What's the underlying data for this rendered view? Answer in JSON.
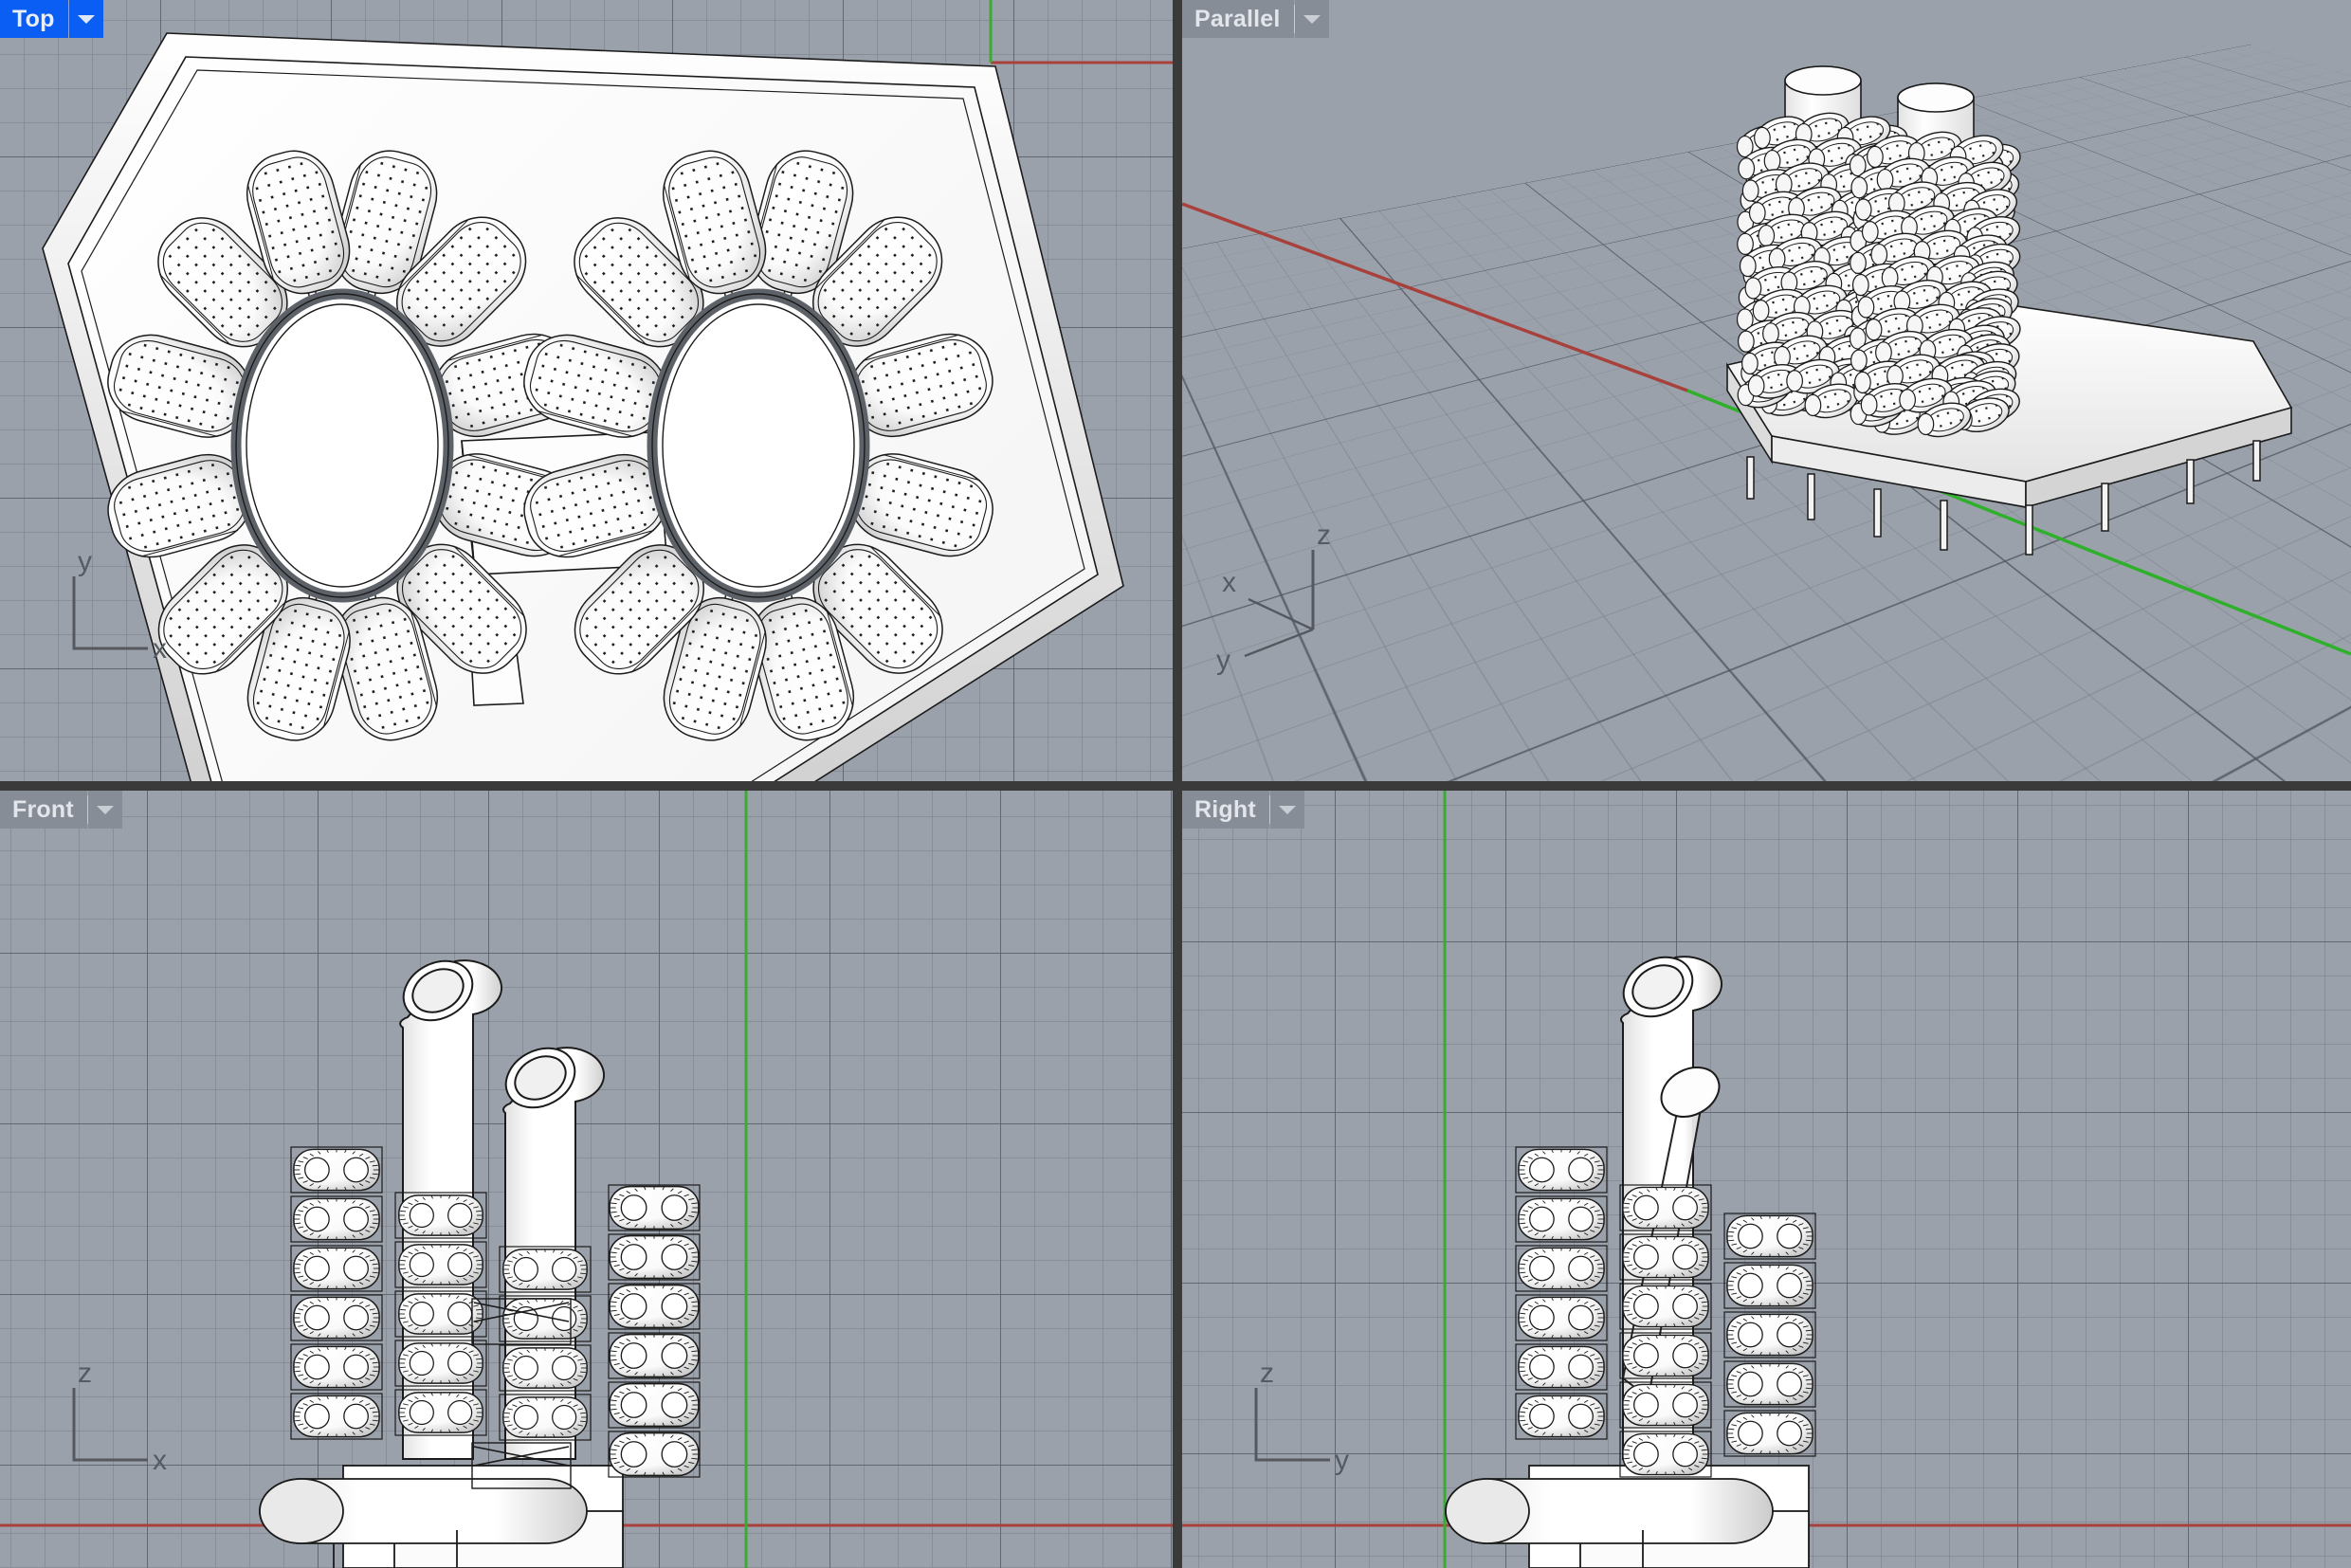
{
  "app": {
    "kind": "cad-modeler-four-viewport",
    "background_color": "#9aa1ab",
    "divider_color": "#3a3a3a"
  },
  "viewports": [
    {
      "id": "top",
      "title": "Top",
      "active": true,
      "projection": "orthographic",
      "title_bg": "#0b5ef4",
      "title_fg": "#e9eef7",
      "dropdown_icon": "chevron-down-icon",
      "gnomon": {
        "vertical_axis": "y",
        "horizontal_axis": "x"
      },
      "world_axes": [
        {
          "name": "x-axis",
          "color": "#a8413c",
          "orientation": "horizontal"
        },
        {
          "name": "y-axis",
          "color": "#3aaa35",
          "orientation": "vertical"
        }
      ]
    },
    {
      "id": "parallel",
      "title": "Parallel",
      "active": false,
      "projection": "parallel-axonometric",
      "title_bg": "#868d97",
      "title_fg": "#e2e5ea",
      "dropdown_icon": "chevron-down-icon",
      "gnomon": {
        "up_axis": "z",
        "left_upper_axis": "x",
        "left_lower_axis": "y"
      },
      "world_axes": [
        {
          "name": "x-axis",
          "color": "#a8413c",
          "orientation": "receding-right"
        },
        {
          "name": "y-axis",
          "color": "#2fb02a",
          "orientation": "receding-left"
        }
      ]
    },
    {
      "id": "front",
      "title": "Front",
      "active": false,
      "projection": "orthographic",
      "title_bg": "#868d97",
      "title_fg": "#e2e5ea",
      "dropdown_icon": "chevron-down-icon",
      "gnomon": {
        "vertical_axis": "z",
        "horizontal_axis": "x"
      },
      "world_axes": [
        {
          "name": "x-axis",
          "color": "#a8413c",
          "orientation": "horizontal"
        },
        {
          "name": "z-axis",
          "color": "#3aaa35",
          "orientation": "vertical"
        }
      ]
    },
    {
      "id": "right",
      "title": "Right",
      "active": false,
      "projection": "orthographic",
      "title_bg": "#868d97",
      "title_fg": "#e2e5ea",
      "dropdown_icon": "chevron-down-icon",
      "gnomon": {
        "vertical_axis": "z",
        "horizontal_axis": "y"
      },
      "world_axes": [
        {
          "name": "y-axis",
          "color": "#a8413c",
          "orientation": "horizontal"
        },
        {
          "name": "z-axis",
          "color": "#3aaa35",
          "orientation": "vertical"
        }
      ]
    }
  ],
  "model": {
    "description": "two-core residential tower with stacked modular pods on a faceted podium slab",
    "shading": "white shaded surfaces with black wireframe edges and dotted facade texture",
    "cores": 2,
    "core_shape": "cylinder with angled top cut",
    "pod_rings_per_core": 10,
    "pods_per_ring": 12,
    "podium": "polygonal slab with chamfered perimeter"
  }
}
